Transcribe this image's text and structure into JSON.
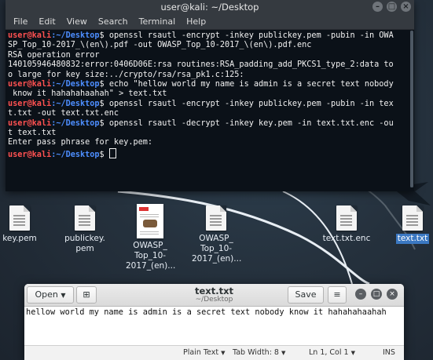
{
  "terminal": {
    "title": "user@kali: ~/Desktop",
    "menu": [
      "File",
      "Edit",
      "View",
      "Search",
      "Terminal",
      "Help"
    ],
    "prompt_user": "user@kali",
    "prompt_path": ":~/Desktop",
    "prompt_symbol": "$ ",
    "lines": [
      {
        "type": "prompt",
        "text": "openssl rsautl -encrypt -inkey publickey.pem -pubin -in OWA"
      },
      {
        "type": "out",
        "text": "SP_Top_10-2017_\\(en\\).pdf -out OWASP_Top_10-2017_\\(en\\).pdf.enc"
      },
      {
        "type": "out",
        "text": "RSA operation error"
      },
      {
        "type": "out",
        "text": "140105946480832:error:0406D06E:rsa routines:RSA_padding_add_PKCS1_type_2:data to"
      },
      {
        "type": "out",
        "text": "o large for key size:../crypto/rsa/rsa_pk1.c:125:"
      },
      {
        "type": "prompt",
        "text": "echo \"hellow world my name is admin is a secret text nobody"
      },
      {
        "type": "out",
        "text": " know it hahahahaahah\" > text.txt"
      },
      {
        "type": "prompt",
        "text": "openssl rsautl -encrypt -inkey publickey.pem -pubin -in tex"
      },
      {
        "type": "out",
        "text": "t.txt -out text.txt.enc"
      },
      {
        "type": "prompt",
        "text": "openssl rsautl -decrypt -inkey key.pem -in text.txt.enc -ou"
      },
      {
        "type": "out",
        "text": "t text.txt"
      },
      {
        "type": "out",
        "text": "Enter pass phrase for key.pem:"
      },
      {
        "type": "prompt",
        "text": ""
      }
    ]
  },
  "desktop": {
    "icons": [
      {
        "label": "key.pem"
      },
      {
        "label": "publickey.\npem"
      },
      {
        "label": "OWASP_\nTop_10-\n2017_(en)..."
      },
      {
        "label": "OWASP_\nTop_10-\n2017_(en)..."
      },
      {
        "label": "text.txt.enc"
      },
      {
        "label": "text.txt"
      }
    ]
  },
  "gedit": {
    "open_label": "Open",
    "save_label": "Save",
    "title": "text.txt",
    "subtitle": "~/Desktop",
    "content": "hellow world my name is admin is a secret text nobody know it hahahahaahah",
    "status": {
      "language": "Plain Text",
      "tab_width": "Tab Width: 8",
      "position": "Ln 1, Col 1",
      "mode": "INS"
    }
  }
}
